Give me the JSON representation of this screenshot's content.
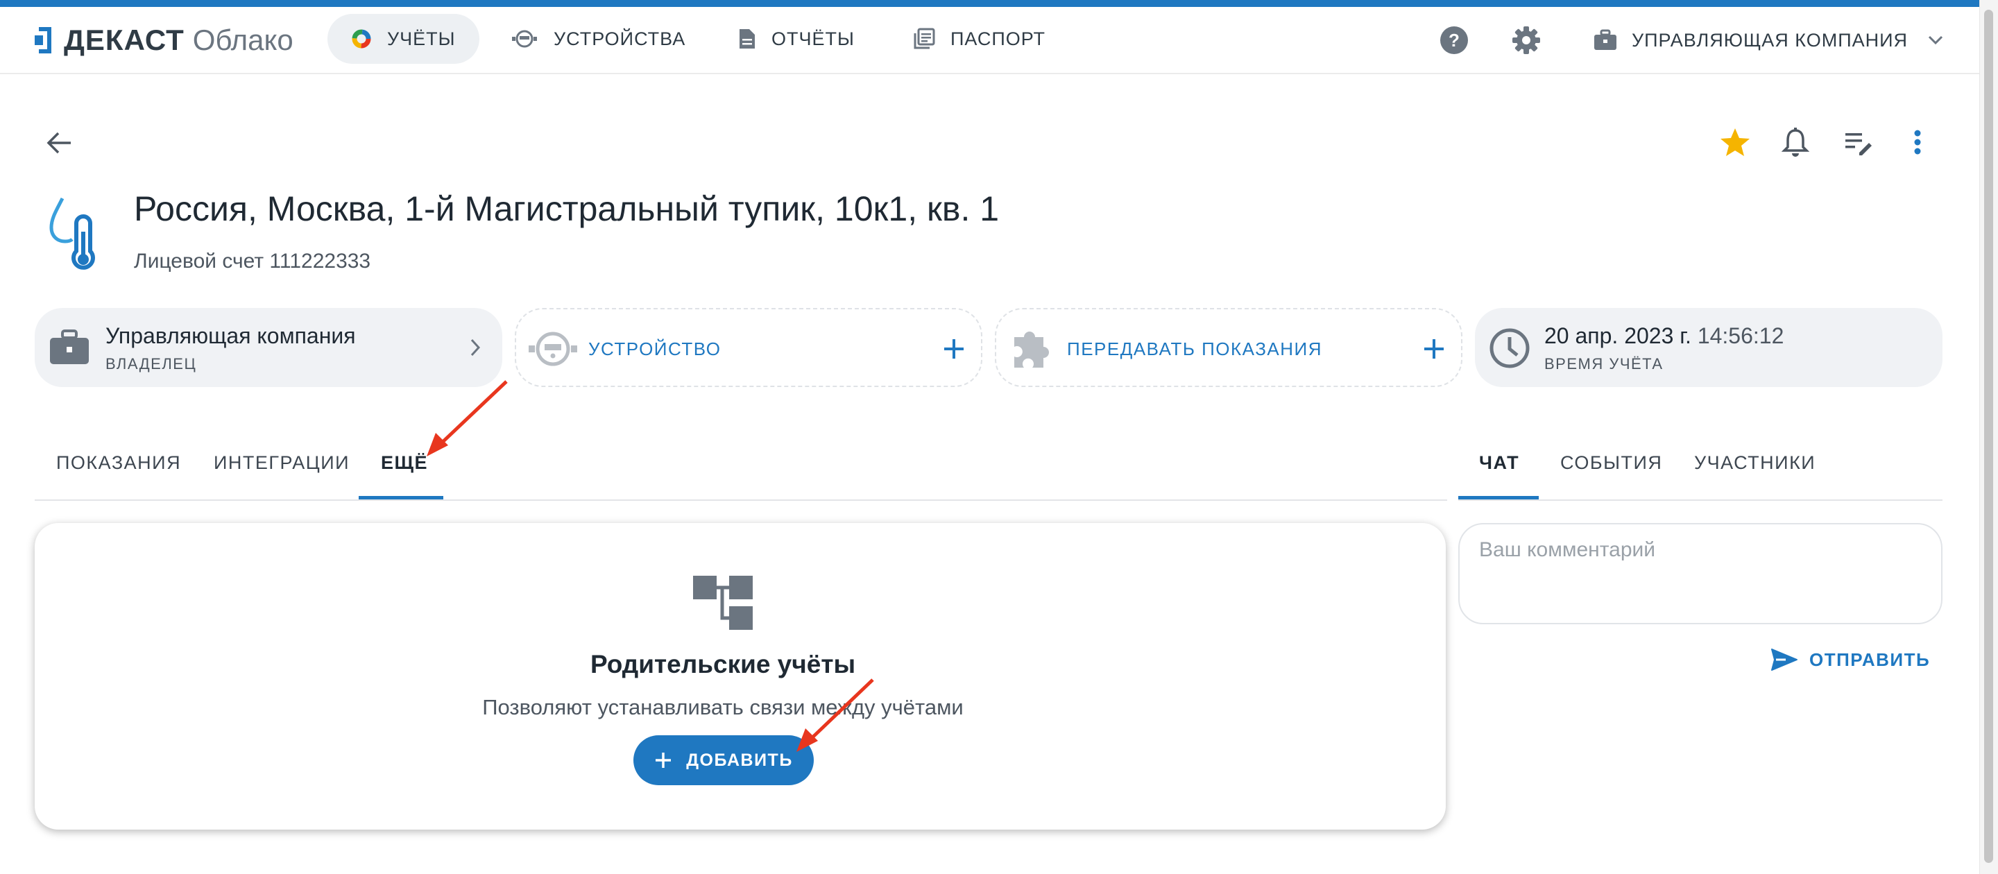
{
  "app": {
    "brand": "ДЕКАСТ",
    "brand_sub": "Облако"
  },
  "nav": {
    "items": [
      {
        "label": "УЧЁТЫ",
        "icon": "colorful-wheel-icon",
        "active": true
      },
      {
        "label": "УСТРОЙСТВА",
        "icon": "meter-icon",
        "active": false
      },
      {
        "label": "ОТЧЁТЫ",
        "icon": "document-icon",
        "active": false
      },
      {
        "label": "ПАСПОРТ",
        "icon": "library-icon",
        "active": false
      }
    ],
    "company": "УПРАВЛЯЮЩАЯ КОМПАНИЯ"
  },
  "header": {
    "title": "Россия, Москва, 1-й Магистральный тупик, 10к1, кв. 1",
    "subtitle": "Лицевой счет 111222333"
  },
  "cards": {
    "owner": {
      "name": "Управляющая компания",
      "role": "ВЛАДЕЛЕЦ"
    },
    "device": {
      "label": "УСТРОЙСТВО"
    },
    "transfer": {
      "label": "ПЕРЕДАВАТЬ ПОКАЗАНИЯ"
    },
    "time": {
      "date": "20 апр. 2023 г.",
      "clock": "14:56:12",
      "label": "ВРЕМЯ УЧЁТА"
    }
  },
  "tabs": {
    "left": [
      "ПОКАЗАНИЯ",
      "ИНТЕГРАЦИИ",
      "ЕЩЁ"
    ],
    "left_active": "ЕЩЁ",
    "right": [
      "ЧАТ",
      "СОБЫТИЯ",
      "УЧАСТНИКИ"
    ],
    "right_active": "ЧАТ"
  },
  "parents": {
    "title": "Родительские учёты",
    "description": "Позволяют устанавливать связи между учётами",
    "add_label": "ДОБАВИТЬ"
  },
  "chat": {
    "placeholder": "Ваш комментарий",
    "send_label": "ОТПРАВИТЬ"
  },
  "colors": {
    "accent": "#1f78c1",
    "star": "#f5b400",
    "annotation": "#e8361e"
  }
}
